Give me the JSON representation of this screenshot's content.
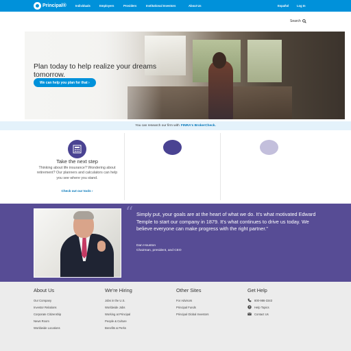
{
  "header": {
    "logo_text": "Principal®",
    "nav": [
      "Individuals",
      "Employers",
      "Providers",
      "Institutional Investors",
      "About Us"
    ],
    "right_nav": [
      "Español",
      "Log In"
    ],
    "search_label": "Search"
  },
  "hero": {
    "title": "Plan today to help realize your dreams tomorrow.",
    "button": "We can help you plan for that ›"
  },
  "notice": {
    "text": "You can research our firm with",
    "link": "FINRA's BrokerCheck."
  },
  "cards": [
    {
      "icon": "calculator-icon",
      "title": "Take the next step",
      "text": "Thinking about life insurance? Wondering about retirement? Our planners and calculators can help you see where you stand.",
      "link": "Check out our tools ›"
    },
    {
      "icon": "placeholder-icon"
    },
    {
      "icon": "placeholder-icon"
    }
  ],
  "quote": {
    "mark": "“",
    "text": "Simply put, your goals are at the heart of what we do. It's what motivated Edward Temple to start our company in 1879. It's what continues to drive us today. We believe everyone can make progress with the right partner.”",
    "name": "Dan Houston",
    "role": "Chairman, president, and CEO"
  },
  "footer": {
    "about": {
      "title": "About Us",
      "links": [
        "Our Company",
        "Investor Relations",
        "Corporate Citizenship",
        "News Room",
        "Worldwide Locations"
      ]
    },
    "hiring": {
      "title": "We're Hiring",
      "links": [
        "Jobs in the U.S.",
        "Worldwide Jobs",
        "Working at Principal",
        "People & Culture",
        "Benefits & Perks"
      ]
    },
    "other": {
      "title": "Other Sites",
      "links": [
        "For Advisors",
        "Principal Funds",
        "Principal Global Investors"
      ]
    },
    "help": {
      "title": "Get Help",
      "links": [
        "800-986-3343",
        "Help Topics",
        "Contact Us"
      ]
    }
  },
  "colors": {
    "brand_blue": "#0091da",
    "purple": "#574c95",
    "footer_bg": "#ececec"
  }
}
